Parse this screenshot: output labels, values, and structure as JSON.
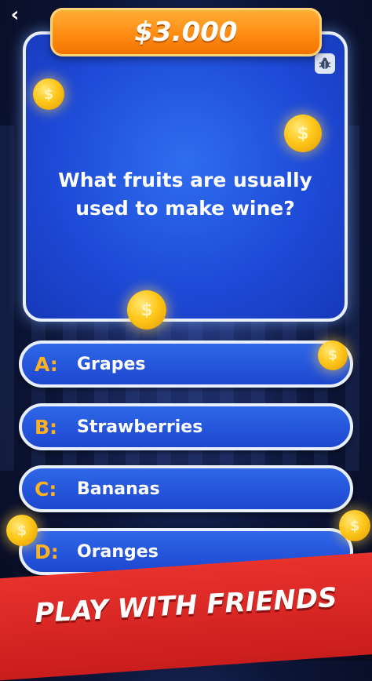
{
  "prize": {
    "amount": "$3.000"
  },
  "question": {
    "text": "What fruits are usually used to make wine?"
  },
  "answers": [
    {
      "letter": "A:",
      "text": "Grapes"
    },
    {
      "letter": "B:",
      "text": "Strawberries"
    },
    {
      "letter": "C:",
      "text": "Bananas"
    },
    {
      "letter": "D:",
      "text": "Oranges"
    }
  ],
  "banner": {
    "text": "PLAY WITH FRIENDS"
  },
  "icons": {
    "back": "back-arrow-icon",
    "bug": "bug-report-icon",
    "coin": "dollar-coin-icon",
    "coin_symbol": "$"
  },
  "colors": {
    "card_blue": "#1d49d6",
    "prize_orange": "#ff8b12",
    "answer_letter": "#ffb21e",
    "banner_red": "#d92424"
  }
}
